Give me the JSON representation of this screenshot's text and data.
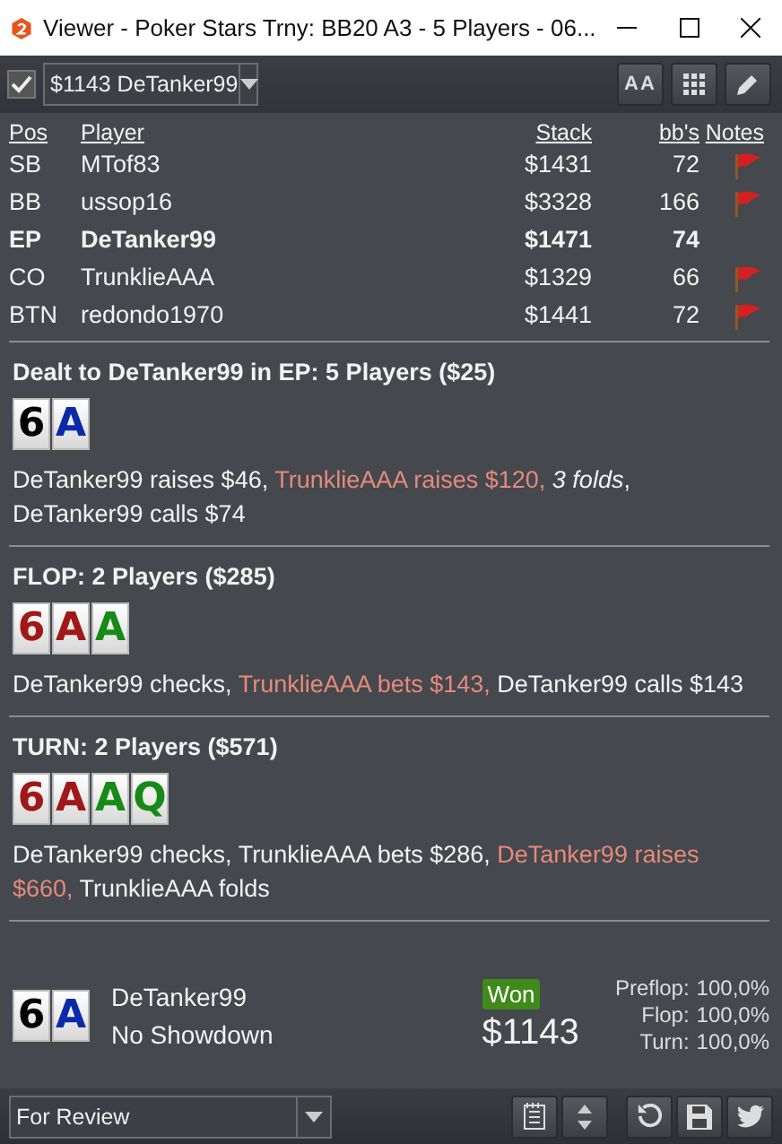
{
  "window": {
    "title": "Viewer - Poker Stars Trny: BB20 A3 - 5 Players - 06..."
  },
  "toolbar": {
    "checked": true,
    "player_select": "$1143 DeTanker99",
    "font_button": "AA"
  },
  "table": {
    "columns": [
      "Pos",
      "Player",
      "Stack",
      "bb's",
      "Notes"
    ],
    "rows": [
      {
        "pos": "SB",
        "player": "MTof83",
        "stack": "$1431",
        "bbs": "72",
        "bold": false,
        "flagged": true
      },
      {
        "pos": "BB",
        "player": "ussop16",
        "stack": "$3328",
        "bbs": "166",
        "bold": false,
        "flagged": true
      },
      {
        "pos": "EP",
        "player": "DeTanker99",
        "stack": "$1471",
        "bbs": "74",
        "bold": true,
        "flagged": false
      },
      {
        "pos": "CO",
        "player": "TrunklieAAA",
        "stack": "$1329",
        "bbs": "66",
        "bold": false,
        "flagged": true
      },
      {
        "pos": "BTN",
        "player": "redondo1970",
        "stack": "$1441",
        "bbs": "72",
        "bold": false,
        "flagged": true
      }
    ]
  },
  "streets": [
    {
      "title": "Dealt to DeTanker99 in EP: 5 Players ($25)",
      "cards": [
        {
          "rank": "6",
          "color": "#000000"
        },
        {
          "rank": "A",
          "color": "#0a2aa8"
        }
      ],
      "actions": [
        {
          "kind": "plain",
          "text": "DeTanker99 raises $46, "
        },
        {
          "kind": "opponent",
          "text": "TrunklieAAA raises $120, "
        },
        {
          "kind": "italic",
          "text": "3 folds"
        },
        {
          "kind": "plain",
          "text": ", DeTanker99 calls $74"
        }
      ]
    },
    {
      "title": "FLOP: 2 Players ($285)",
      "cards": [
        {
          "rank": "6",
          "color": "#a01818"
        },
        {
          "rank": "A",
          "color": "#a01818"
        },
        {
          "rank": "A",
          "color": "#178a17"
        }
      ],
      "actions": [
        {
          "kind": "plain",
          "text": "DeTanker99 checks, "
        },
        {
          "kind": "opponent",
          "text": "TrunklieAAA bets $143, "
        },
        {
          "kind": "plain",
          "text": "DeTanker99 calls $143"
        }
      ]
    },
    {
      "title": "TURN: 2 Players ($571)",
      "cards": [
        {
          "rank": "6",
          "color": "#a01818"
        },
        {
          "rank": "A",
          "color": "#a01818"
        },
        {
          "rank": "A",
          "color": "#178a17"
        },
        {
          "rank": "Q",
          "color": "#178a17"
        }
      ],
      "actions": [
        {
          "kind": "plain",
          "text": "DeTanker99 checks, TrunklieAAA bets $286, "
        },
        {
          "kind": "opponent",
          "text": "DeTanker99 raises $660, "
        },
        {
          "kind": "plain",
          "text": "TrunklieAAA folds"
        }
      ]
    }
  ],
  "summary": {
    "cards": [
      {
        "rank": "6",
        "color": "#000000"
      },
      {
        "rank": "A",
        "color": "#0a2aa8"
      }
    ],
    "player": "DeTanker99",
    "result": "No Showdown",
    "badge": "Won",
    "amount": "$1143",
    "equity": [
      {
        "label": "Preflop:",
        "value": "100,0%"
      },
      {
        "label": "Flop:",
        "value": "100,0%"
      },
      {
        "label": "Turn:",
        "value": "100,0%"
      }
    ]
  },
  "footer": {
    "tag_select": "For Review"
  }
}
